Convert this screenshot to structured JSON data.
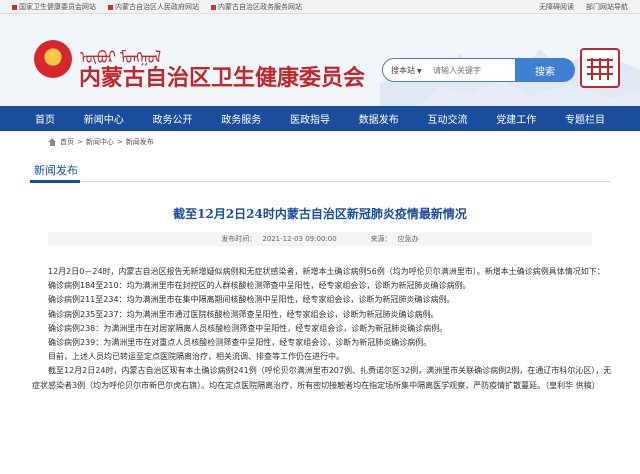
{
  "topbar": {
    "links": [
      "国家卫生健康委员会网站",
      "内蒙古自治区人民政府网站",
      "内蒙古自治区政务服务网站"
    ],
    "accessibility": "无障碍阅读",
    "dept_portal": "部门网站导航"
  },
  "header": {
    "mongolian_title": "ᠥᠪᠦᠷ ᠮᠣᠩᠭᠣᠯ",
    "site_title": "内蒙古自治区卫生健康委员会",
    "search_scope": "搜本站",
    "search_placeholder": "请输入关键字",
    "search_button": "搜索",
    "seal_text": "内蒙古卫健"
  },
  "nav": {
    "items": [
      "首页",
      "新闻中心",
      "政务公开",
      "政务服务",
      "医政指导",
      "数据发布",
      "互动交流",
      "党建工作",
      "专题栏目"
    ]
  },
  "breadcrumb": [
    "首页",
    "新闻中心",
    "新闻发布"
  ],
  "section": {
    "title": "新闻发布"
  },
  "article": {
    "title": "截至12月2日24时内蒙古自治区新冠肺炎疫情最新情况",
    "publish_label": "发布时间：",
    "publish_time": "2021-12-03 09:00:00",
    "source_label": "来源：",
    "source": "应急办",
    "paragraphs": [
      "12月2日0－24时，内蒙古自治区报告无新增疑似病例和无症状感染者，新增本土确诊病例56例（均为呼伦贝尔满洲里市）。新增本土确诊病例具体情况如下：",
      "确诊病例184至210：均为满洲里市在封控区的人群核酸检测筛查中呈阳性，经专家组会诊，诊断为新冠肺炎确诊病例。",
      "确诊病例211至234：均为满洲里市在集中隔离期间核酸检测中呈阳性，经专家组会诊，诊断为新冠肺炎确诊病例。",
      "确诊病例235至237：均为满洲里市通过医院核酸检测筛查呈阳性，经专家组会诊，诊断为新冠肺炎确诊病例。",
      "确诊病例238：为满洲里市在对居家隔离人员核酸检测筛查中呈阳性，经专家组会诊，诊断为新冠肺炎确诊病例。",
      "确诊病例239：为满洲里市在对重点人员核酸检测筛查中呈阳性，经专家组会诊，诊断为新冠肺炎确诊病例。",
      "目前，上述人员均已转运至定点医院隔离治疗，相关流调、排查等工作仍在进行中。",
      "截至12月2日24时，内蒙古自治区现有本土确诊病例241例（呼伦贝尔满洲里市207例、扎赉诺尔区32例，满洲里市关联确诊病例2例，在通辽市科尔沁区），无症状感染者3例（均为呼伦贝尔市新巴尔虎右旗）。均在定点医院隔离治疗，所有密切接触者均在指定场所集中隔离医学观察，严防疫情扩散蔓延。（皇利华 供稿）"
    ]
  }
}
